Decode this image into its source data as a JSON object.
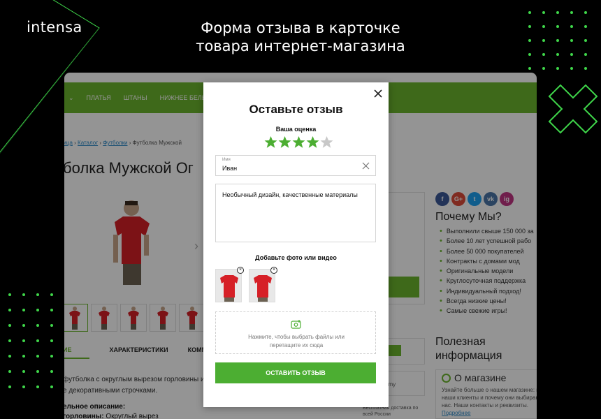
{
  "brand": "intensa",
  "headline": {
    "line1": "Форма отзыва в карточке",
    "line2": "товара интернет-магазина"
  },
  "shop": {
    "nav": [
      "ПЛАТЬЯ",
      "ШТАНЫ",
      "НИЖНЕЕ БЕЛЬЕ"
    ],
    "breadcrumb": {
      "home": "ница",
      "catalog": "Каталог",
      "category": "Футболки",
      "current": "Футболка Мужской"
    },
    "product_title": "болка Мужской Ог",
    "tabs": [
      "ИЕ",
      "ХАРАКТЕРИСТИКИ",
      "КОММЕНТАРИ"
    ],
    "description": "футболка с округлым вырезом горловины и ко...е декоративными строчками.",
    "desc_line1": "футболка с округлым вырезом горловины и ко",
    "desc_line2": "е декоративными строчками.",
    "full_desc_label": "ельное описание:",
    "neck_label": "горловины:",
    "neck_value": "Округлый вырез",
    "social": [
      "f",
      "G+",
      "t",
      "vk",
      "ig"
    ],
    "why_title": "Почему Мы?",
    "why_items": [
      "Выполнили свыше 150 000 за",
      "Более 10 лет успешной рабо",
      "Более 50 000 покупателей",
      "Контракты с домами мод",
      "Оригинальные модели",
      "Круглосуточная поддержка",
      "Индивидуальный подход!",
      "Всегда низкие цены!",
      "Самые свежие игры!"
    ],
    "useful_title_1": "Полезная",
    "useful_title_2": "информация",
    "about_title": "О магазине",
    "about_text_1": "Узнайте больше о нашем магазине: кто",
    "about_text_2": "наши клиенты и почему они выбирают",
    "about_text_3": "нас. Наши контакты и реквизиты.",
    "about_link": "Подробнее",
    "delivery_1": "Бесплатная доставка по",
    "delivery_2": "всей России",
    "amount_fragment": "amy"
  },
  "modal": {
    "title": "Оставьте отзыв",
    "rating_label": "Ваша оценка",
    "rating": 4,
    "rating_max": 5,
    "name_label": "Имя",
    "name_value": "Иван",
    "review_text": "Необычный дизайн, качественные материалы",
    "add_media_label": "Добавьте фото или видео",
    "drop_text_1": "Нажмите, чтобы выбрать файлы или",
    "drop_text_2": "перетащите их сюда",
    "submit_label": "ОСТАВИТЬ ОТЗЫВ",
    "photo_remove": "×"
  },
  "colors": {
    "accent": "#4cae32",
    "nav": "#6cb52d",
    "star_off": "#c8c8c8",
    "tshirt": "#d62027"
  }
}
